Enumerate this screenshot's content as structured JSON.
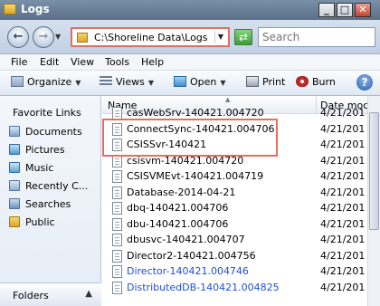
{
  "window": {
    "title": "Logs"
  },
  "address": {
    "path": "C:\\Shoreline Data\\Logs"
  },
  "search": {
    "placeholder": "Search"
  },
  "menu": [
    "File",
    "Edit",
    "View",
    "Tools",
    "Help"
  ],
  "toolbar": {
    "organize": "Organize",
    "views": "Views",
    "open": "Open",
    "print": "Print",
    "burn": "Burn"
  },
  "nav": {
    "title": "Favorite Links",
    "items": [
      "Documents",
      "Pictures",
      "Music",
      "Recently C...",
      "Searches",
      "Public"
    ],
    "folders": "Folders"
  },
  "columns": {
    "name": "Name",
    "date": "Date moc"
  },
  "files": [
    {
      "name": "casWebSrv-140421.004720",
      "date": "4/21/201"
    },
    {
      "name": "ConnectSync-140421.004706",
      "date": "4/21/201"
    },
    {
      "name": "CSISSvr-140421",
      "date": "4/21/201"
    },
    {
      "name": "csisvm-140421.004720",
      "date": "4/21/201"
    },
    {
      "name": "CSISVMEvt-140421.004719",
      "date": "4/21/201"
    },
    {
      "name": "Database-2014-04-21",
      "date": "4/21/201"
    },
    {
      "name": "dbq-140421.004706",
      "date": "4/21/201"
    },
    {
      "name": "dbu-140421.004706",
      "date": "4/21/201"
    },
    {
      "name": "dbusvc-140421.004707",
      "date": "4/21/201"
    },
    {
      "name": "Director2-140421.004756",
      "date": "4/21/201"
    },
    {
      "name": "Director-140421.004746",
      "date": "4/21/201"
    },
    {
      "name": "DistributedDB-140421.004825",
      "date": "4/21/201"
    }
  ],
  "colors": {
    "highlight": "#e46f61",
    "link_blue": "#1f4fd6"
  }
}
